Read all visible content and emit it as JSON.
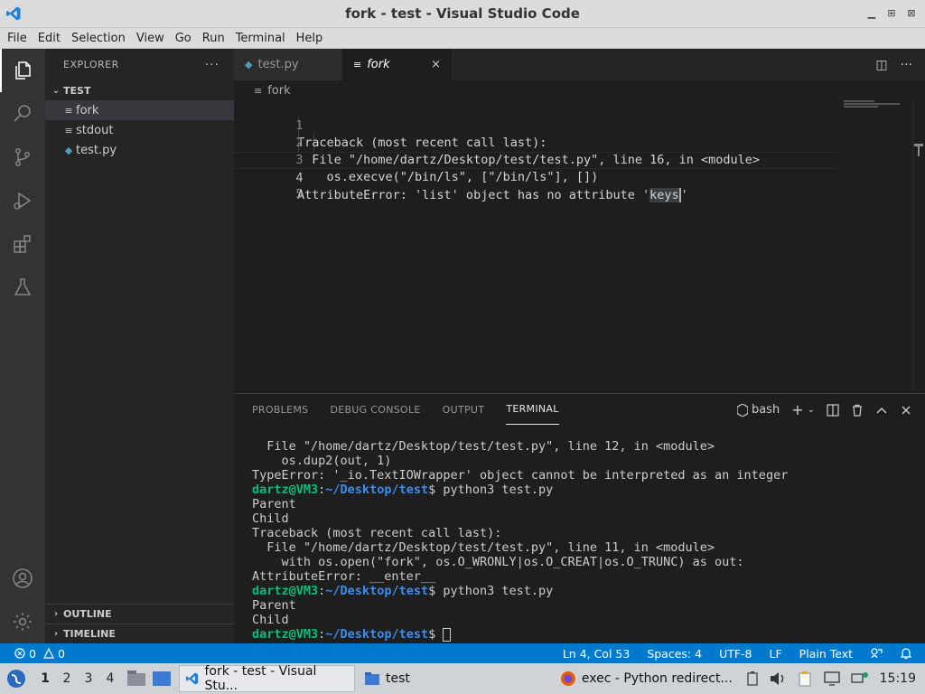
{
  "window": {
    "title": "fork - test - Visual Studio Code"
  },
  "menu": [
    "File",
    "Edit",
    "Selection",
    "View",
    "Go",
    "Run",
    "Terminal",
    "Help"
  ],
  "sidebar": {
    "title": "EXPLORER",
    "more": "···",
    "folder": "TEST",
    "files": [
      {
        "name": "fork",
        "kind": "text",
        "selected": true
      },
      {
        "name": "stdout",
        "kind": "text",
        "selected": false
      },
      {
        "name": "test.py",
        "kind": "python",
        "selected": false
      }
    ],
    "outline": "OUTLINE",
    "timeline": "TIMELINE"
  },
  "tabs": [
    {
      "label": "test.py",
      "active": false
    },
    {
      "label": "fork",
      "active": true
    }
  ],
  "tab_close": "×",
  "editor_actions": {
    "split": "◫",
    "more": "···"
  },
  "breadcrumb": "fork",
  "editor": {
    "lines": [
      {
        "n": "1",
        "text": "Traceback (most recent call last):"
      },
      {
        "n": "2",
        "text": "  File \"/home/dartz/Desktop/test/test.py\", line 16, in <module>"
      },
      {
        "n": "3",
        "text": "    os.execve(\"/bin/ls\", [\"/bin/ls\"], [])"
      },
      {
        "n": "4",
        "text_before": "AttributeError: 'list' object has no attribute '",
        "text_sel": "keys",
        "text_after": "'"
      },
      {
        "n": "5",
        "text": ""
      }
    ]
  },
  "panel": {
    "tabs": [
      "PROBLEMS",
      "DEBUG CONSOLE",
      "OUTPUT",
      "TERMINAL"
    ],
    "active_tab": "TERMINAL",
    "shell": "bash",
    "terminal": {
      "line1": "  File \"/home/dartz/Desktop/test/test.py\", line 12, in <module>",
      "line2": "    os.dup2(out, 1)",
      "line3": "TypeError: '_io.TextIOWrapper' object cannot be interpreted as an integer",
      "prompt_user": "dartz@VM3",
      "prompt_sep": ":",
      "prompt_path": "~/Desktop/test",
      "prompt_end": "$ ",
      "cmd1": "python3 test.py",
      "line5": "Parent",
      "line6": "Child",
      "line7": "Traceback (most recent call last):",
      "line8": "  File \"/home/dartz/Desktop/test/test.py\", line 11, in <module>",
      "line9": "    with os.open(\"fork\", os.O_WRONLY|os.O_CREAT|os.O_TRUNC) as out:",
      "line10": "AttributeError: __enter__",
      "cmd2": "python3 test.py",
      "line12": "Parent",
      "line13": "Child"
    }
  },
  "status": {
    "errors": "0",
    "warnings": "0",
    "position": "Ln 4, Col 53",
    "spaces": "Spaces: 4",
    "encoding": "UTF-8",
    "eol": "LF",
    "language": "Plain Text"
  },
  "taskbar": {
    "workspaces": [
      "1",
      "2",
      "3",
      "4"
    ],
    "active_task": "fork - test - Visual Stu...",
    "folder_task": "test",
    "browser_task": "exec - Python redirect...",
    "clock": "15:19"
  },
  "colors": {
    "statusbar": "#007acc",
    "accent": "#007acc"
  }
}
